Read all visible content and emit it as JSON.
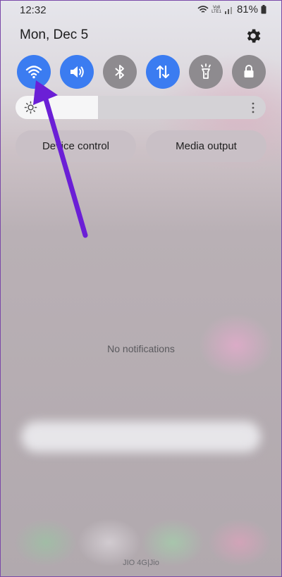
{
  "status_bar": {
    "time": "12:32",
    "volte_top": "Vo8",
    "volte_bottom": "LTE1",
    "battery": "81%"
  },
  "header": {
    "date": "Mon, Dec 5"
  },
  "quick_tiles": [
    {
      "name": "wifi",
      "state": "on",
      "icon": "wifi-icon"
    },
    {
      "name": "sound",
      "state": "on",
      "icon": "volume-icon"
    },
    {
      "name": "bluetooth",
      "state": "off",
      "icon": "bluetooth-icon"
    },
    {
      "name": "mobile-data",
      "state": "on",
      "icon": "data-arrows-icon"
    },
    {
      "name": "flashlight",
      "state": "off",
      "icon": "flashlight-icon"
    },
    {
      "name": "screen-lock",
      "state": "off",
      "icon": "lock-icon"
    }
  ],
  "brightness": {
    "level": 0.33
  },
  "buttons": {
    "device_control": "Device control",
    "media_output": "Media output"
  },
  "notifications": {
    "empty_text": "No notifications"
  },
  "footer": {
    "carrier": "JIO 4G|Jio"
  },
  "colors": {
    "tile_on": "#3b7cf1",
    "tile_off": "#8e8b8f",
    "annotation_arrow": "#6b1fd6"
  }
}
